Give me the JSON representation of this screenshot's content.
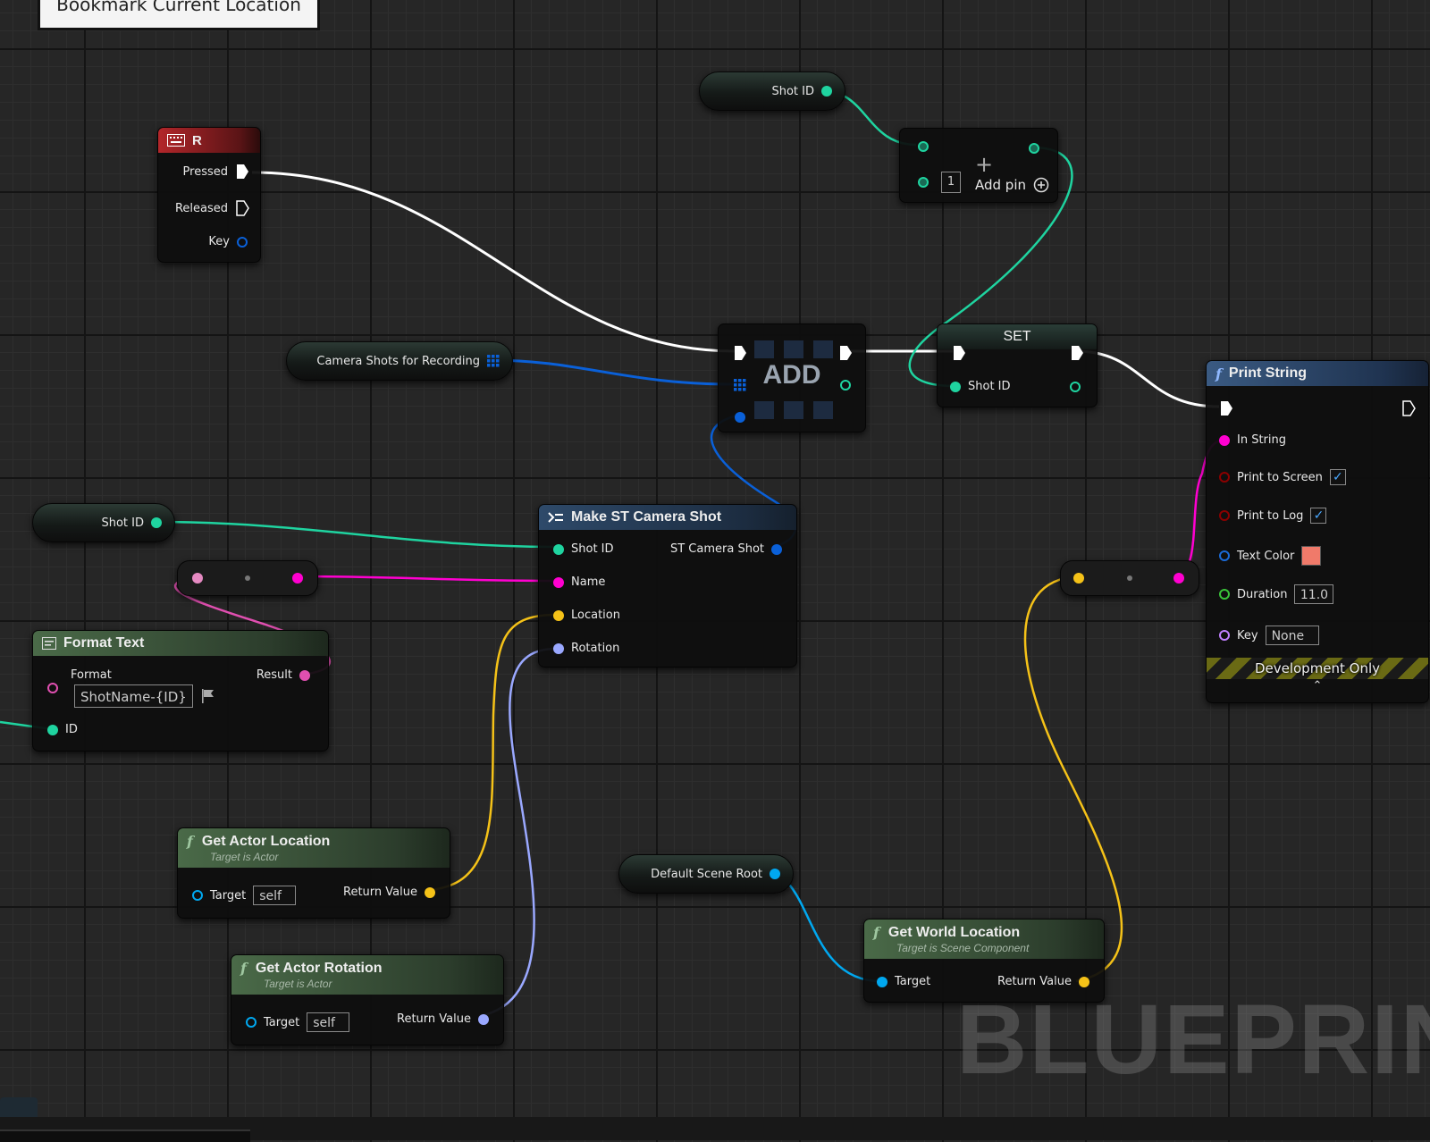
{
  "comment": {
    "title": "Bookmark Current Location"
  },
  "event_r": {
    "title": "R",
    "pressed": "Pressed",
    "released": "Released",
    "key": "Key"
  },
  "shot_id_top": {
    "label": "Shot ID"
  },
  "shot_id_left": {
    "label": "Shot ID"
  },
  "add_pin_node": {
    "index": "1",
    "add_pin": "Add pin"
  },
  "camera_shots": {
    "label": "Camera Shots for Recording"
  },
  "add_node": {
    "title": "ADD"
  },
  "set_node": {
    "title": "SET",
    "shot_id": "Shot ID"
  },
  "print_string": {
    "title": "Print String",
    "in_string": "In String",
    "print_to_screen": "Print to Screen",
    "print_to_log": "Print to Log",
    "text_color": "Text Color",
    "text_color_value": "#f07a6a",
    "duration": "Duration",
    "duration_value": "11.0",
    "key": "Key",
    "key_value": "None",
    "dev_only": "Development Only"
  },
  "make_shot": {
    "title": "Make ST Camera Shot",
    "shot_id": "Shot ID",
    "name": "Name",
    "location": "Location",
    "rotation": "Rotation",
    "output": "ST Camera Shot"
  },
  "format_text": {
    "title": "Format Text",
    "format": "Format",
    "format_value": "ShotName-{ID}",
    "result": "Result",
    "id": "ID"
  },
  "get_actor_location": {
    "title": "Get Actor Location",
    "subtitle": "Target is Actor",
    "target": "Target",
    "target_value": "self",
    "return_value": "Return Value"
  },
  "get_actor_rotation": {
    "title": "Get Actor Rotation",
    "subtitle": "Target is Actor",
    "target": "Target",
    "target_value": "self",
    "return_value": "Return Value"
  },
  "default_scene_root": {
    "label": "Default Scene Root"
  },
  "get_world_location": {
    "title": "Get World Location",
    "subtitle": "Target is Scene Component",
    "target": "Target",
    "return_value": "Return Value"
  },
  "watermark": {
    "text": "BLUEPRINT"
  },
  "colors": {
    "exec": "#ffffff",
    "integer": "#1fd4a0",
    "text": "#e04fb0",
    "string": "#ff00d0",
    "vector": "#f5c218",
    "rotator": "#9aa8ff",
    "object": "#00a8f0",
    "struct": "#0a60d8",
    "bool": "#8b0000",
    "linear_color": "#1a6ad8",
    "float": "#3ac23a",
    "name": "#c080ff"
  }
}
